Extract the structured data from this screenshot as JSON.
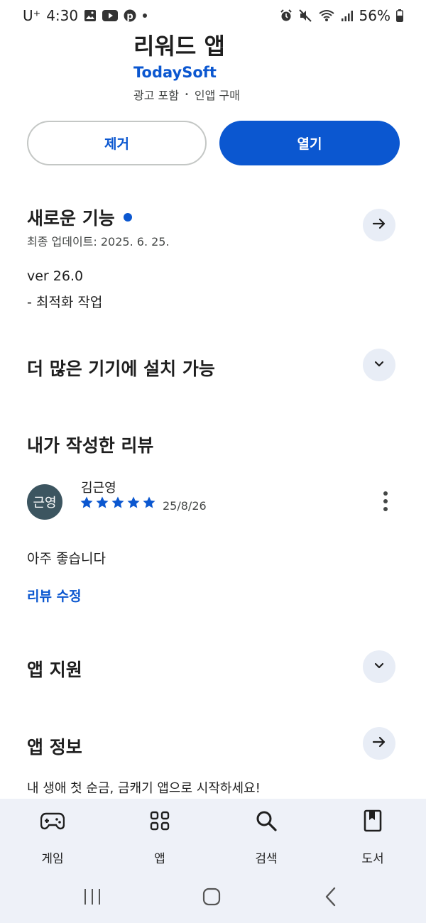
{
  "status_bar": {
    "carrier": "U⁺",
    "time": "4:30",
    "battery": "56%"
  },
  "app": {
    "title": "리워드 앱",
    "developer": "TodaySoft",
    "meta_ads": "광고 포함",
    "meta_sep": "•",
    "meta_iap": "인앱 구매"
  },
  "actions": {
    "remove": "제거",
    "open": "열기"
  },
  "whats_new": {
    "title": "새로운 기능",
    "updated": "최종 업데이트: 2025. 6. 25.",
    "version": "ver 26.0",
    "note": "- 최적화 작업"
  },
  "more_devices": {
    "title": "더 많은 기기에 설치 가능"
  },
  "my_review": {
    "title": "내가 작성한 리뷰",
    "avatar_text": "근영",
    "reviewer": "김근영",
    "rating": 5,
    "date": "25/8/26",
    "text": "아주 좋습니다",
    "edit": "리뷰 수정"
  },
  "app_support": {
    "title": "앱 지원"
  },
  "app_info": {
    "title": "앱 정보",
    "description": "내 생애 첫 순금, 금캐기 앱으로 시작하세요!"
  },
  "bottom_nav": {
    "items": [
      {
        "label": "게임",
        "icon": "gamepad-icon"
      },
      {
        "label": "앱",
        "icon": "apps-grid-icon"
      },
      {
        "label": "검색",
        "icon": "search-icon"
      },
      {
        "label": "도서",
        "icon": "book-icon"
      }
    ]
  },
  "colors": {
    "accent": "#0b57d0",
    "nav_bg": "#eef1f8",
    "round_btn_bg": "#e8edf6",
    "avatar_bg": "#3c5560"
  }
}
